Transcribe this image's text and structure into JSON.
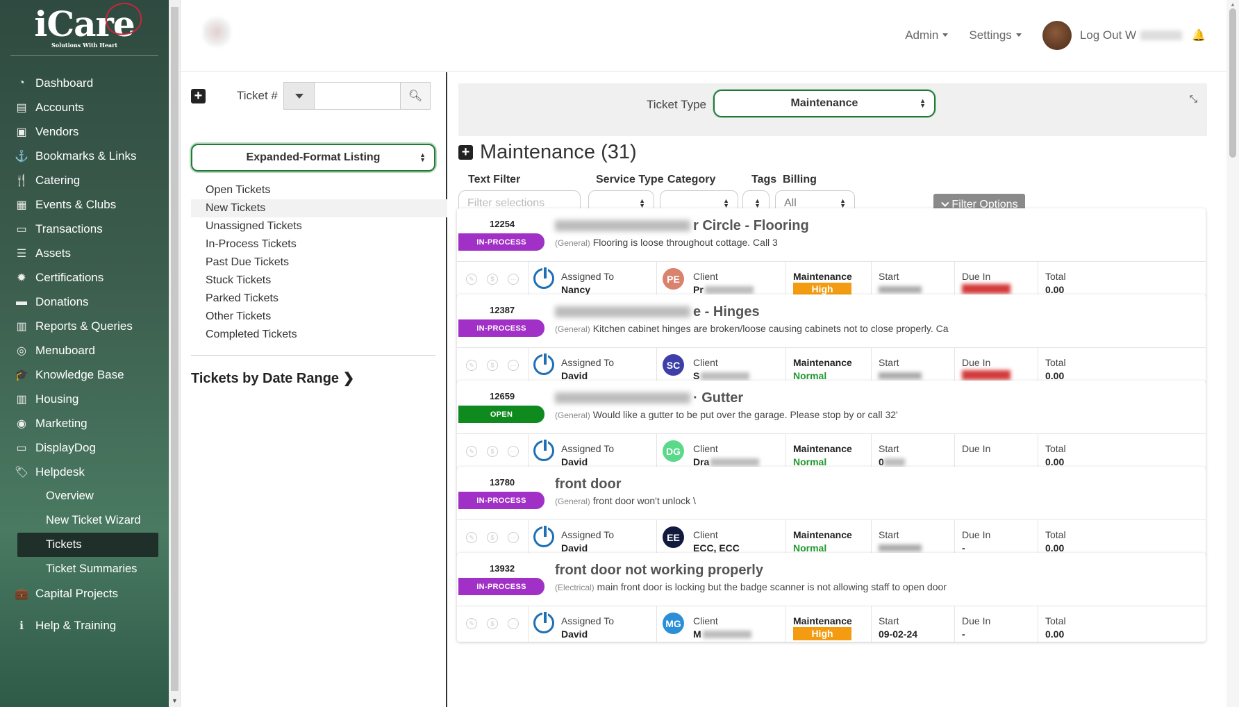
{
  "sidebar": {
    "brand": "iCare",
    "tagline": "Solutions With Heart",
    "items": [
      {
        "label": "Dashboard",
        "icon": "◔"
      },
      {
        "label": "Accounts",
        "icon": "▤"
      },
      {
        "label": "Vendors",
        "icon": "▣"
      },
      {
        "label": "Bookmarks & Links",
        "icon": "⚓"
      },
      {
        "label": "Catering",
        "icon": "🍴"
      },
      {
        "label": "Events & Clubs",
        "icon": "▦"
      },
      {
        "label": "Transactions",
        "icon": "▭"
      },
      {
        "label": "Assets",
        "icon": "☰"
      },
      {
        "label": "Certifications",
        "icon": "✹"
      },
      {
        "label": "Donations",
        "icon": "▬"
      },
      {
        "label": "Reports & Queries",
        "icon": "▥"
      },
      {
        "label": "Menuboard",
        "icon": "◎"
      },
      {
        "label": "Knowledge Base",
        "icon": "🎓"
      },
      {
        "label": "Housing",
        "icon": "▥"
      },
      {
        "label": "Marketing",
        "icon": "◉"
      },
      {
        "label": "DisplayDog",
        "icon": "▭"
      },
      {
        "label": "Helpdesk",
        "icon": "🏷"
      }
    ],
    "subitems": [
      "Overview",
      "New Ticket Wizard",
      "Tickets",
      "Ticket Summaries"
    ],
    "after": [
      {
        "label": "Capital Projects",
        "icon": "💼"
      },
      {
        "label": "Help & Training",
        "icon": "ℹ"
      }
    ]
  },
  "header": {
    "admin": "Admin",
    "settings": "Settings",
    "logout": "Log Out W"
  },
  "left": {
    "ticket_label": "Ticket #",
    "listing": "Expanded-Format Listing",
    "links": [
      "Open Tickets",
      "New Tickets",
      "Unassigned Tickets",
      "In-Process Tickets",
      "Past Due Tickets",
      "Stuck Tickets",
      "Parked Tickets",
      "Other Tickets",
      "Completed Tickets"
    ],
    "date_range": "Tickets by Date Range"
  },
  "right": {
    "ticket_type_label": "Ticket Type",
    "ticket_type": "Maintenance",
    "title": "Maintenance (31)",
    "filters": {
      "text_label": "Text Filter",
      "text_placeholder": "Filter selections",
      "service_label": "Service Type",
      "category_label": "Category",
      "tags_label": "Tags",
      "billing_label": "Billing",
      "billing_value": "All",
      "options_button": "Filter Options"
    }
  },
  "tickets": [
    {
      "id": "12254",
      "status": "IN-PROCESS",
      "title_visible": "r Circle - Flooring",
      "category": "(General)",
      "desc": "Flooring is loose throughout cottage. Call 3",
      "assigned": "Nancy",
      "client_initials": "PE",
      "client_color": "#d9826e",
      "client": "Pr",
      "type": "Maintenance",
      "priority": "High",
      "start": "",
      "due": "",
      "total": "0.00"
    },
    {
      "id": "12387",
      "status": "IN-PROCESS",
      "title_visible": "e - Hinges",
      "category": "(General)",
      "desc": "Kitchen cabinet hinges are broken/loose causing cabinets not to close properly. Ca",
      "assigned": "David",
      "client_initials": "SC",
      "client_color": "#3d3fa8",
      "client": "S",
      "type": "Maintenance",
      "priority": "Normal",
      "start": "",
      "due": "",
      "total": "0.00"
    },
    {
      "id": "12659",
      "status": "OPEN",
      "title_visible": "· Gutter",
      "category": "(General)",
      "desc": "Would like a gutter to be put over the garage. Please stop by or call 32'",
      "assigned": "David",
      "client_initials": "DG",
      "client_color": "#5ad98a",
      "client": "Dra",
      "type": "Maintenance",
      "priority": "Normal",
      "start": "0",
      "due": "",
      "total": "0.00"
    },
    {
      "id": "13780",
      "status": "IN-PROCESS",
      "title_visible": "front door",
      "category": "(General)",
      "desc": "front door won't unlock \\",
      "assigned": "David",
      "client_initials": "EE",
      "client_color": "#111a3c",
      "client": "ECC, ECC",
      "type": "Maintenance",
      "priority": "Normal",
      "start": "",
      "due": "-",
      "total": "0.00"
    },
    {
      "id": "13932",
      "status": "IN-PROCESS",
      "title_visible": "front door not working properly",
      "category": "(Electrical)",
      "desc": "main front door is locking but the badge scanner is not allowing staff to open door",
      "assigned": "David",
      "client_initials": "MG",
      "client_color": "#2a8fd6",
      "client": "M",
      "type": "Maintenance",
      "priority": "High",
      "start": "09-02-24",
      "due": "-",
      "total": "0.00"
    }
  ],
  "card_labels": {
    "assigned": "Assigned To",
    "client": "Client",
    "start": "Start",
    "due": "Due In",
    "total": "Total"
  }
}
